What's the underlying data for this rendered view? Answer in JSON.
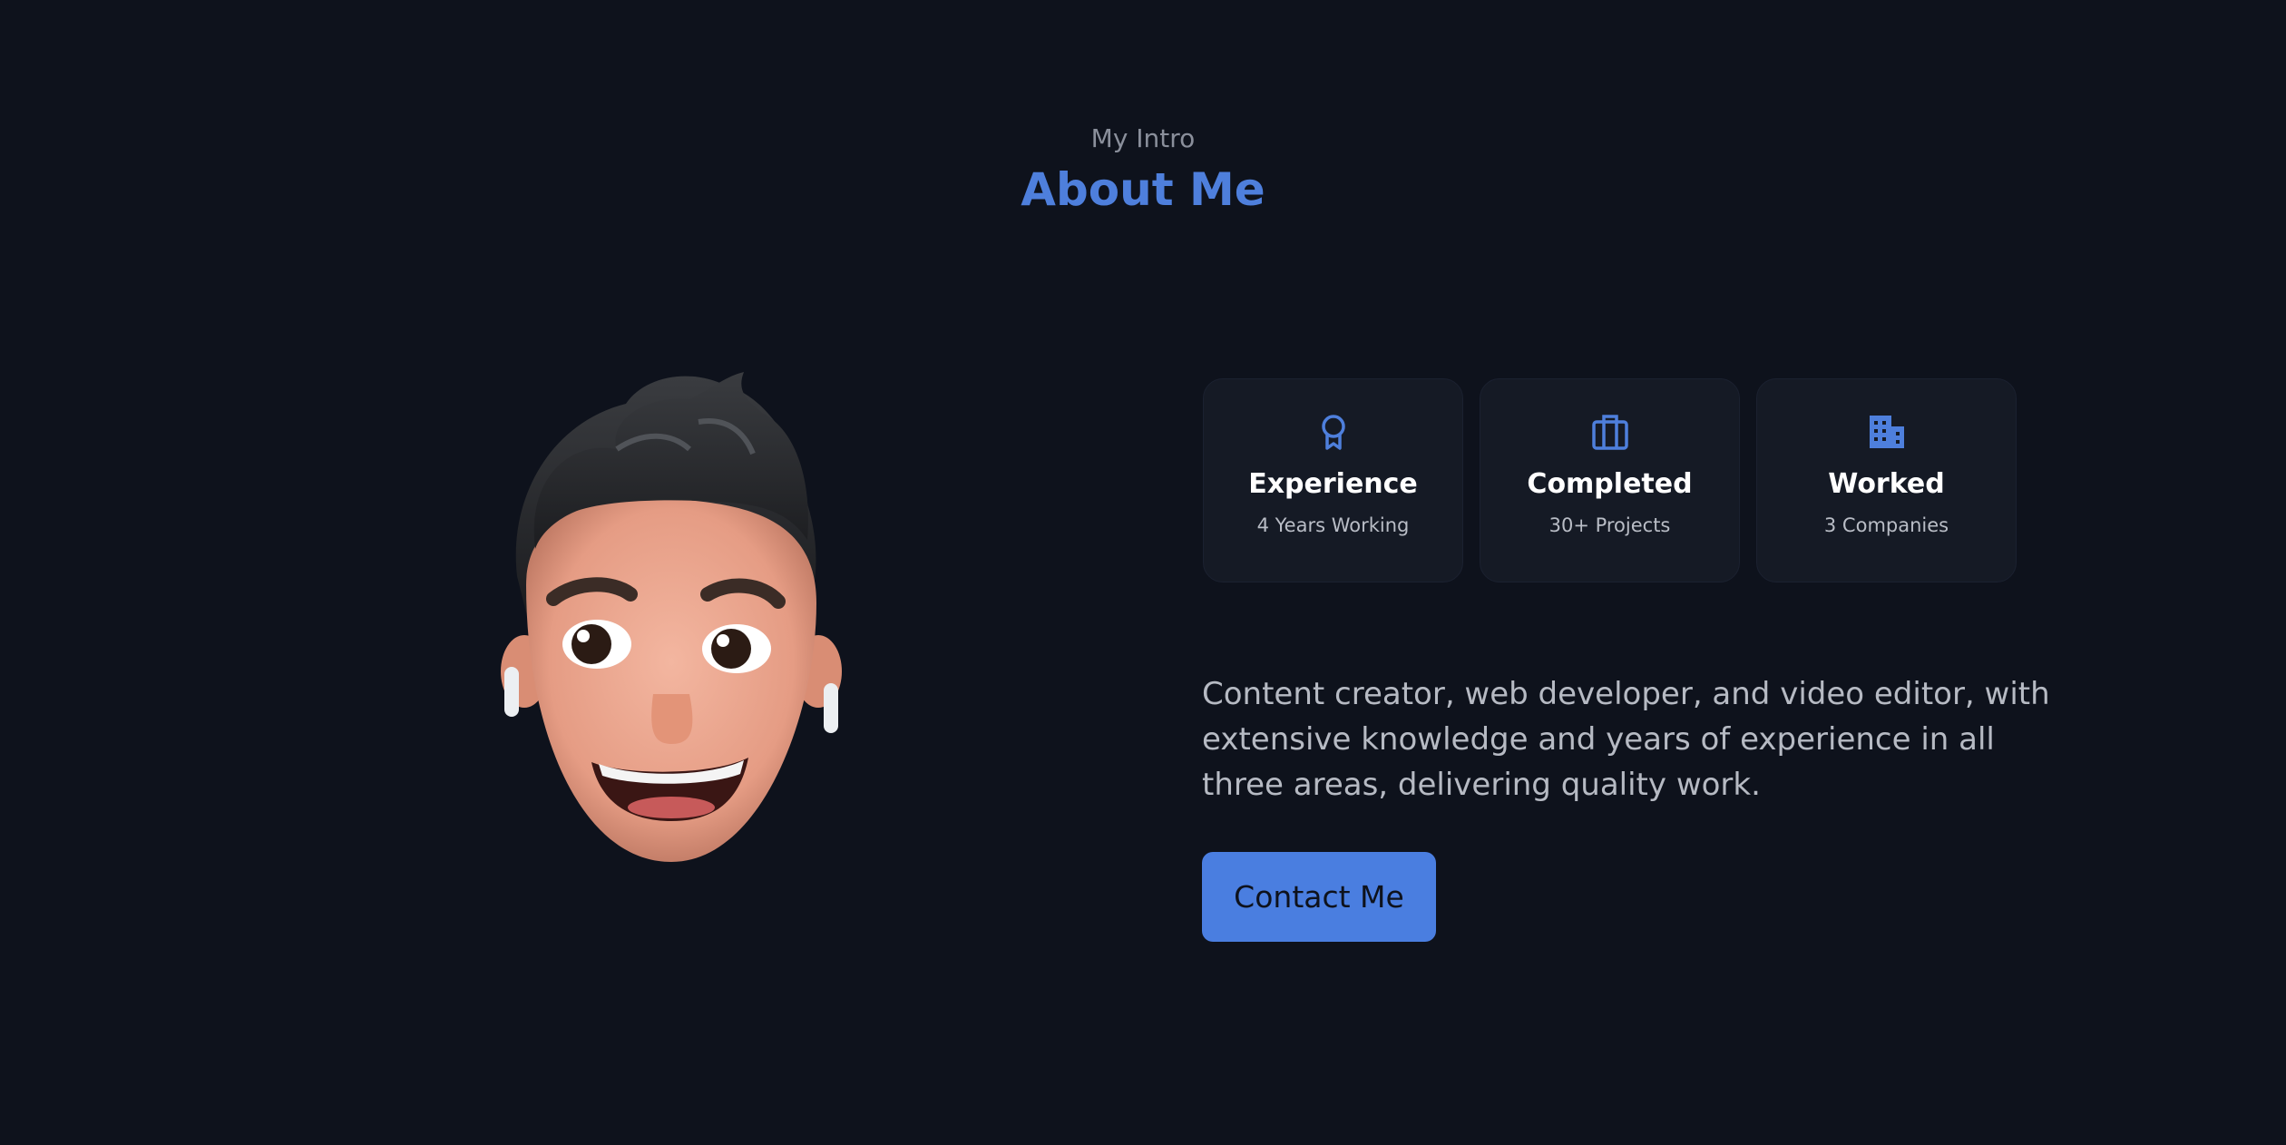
{
  "header": {
    "subtitle": "My Intro",
    "title": "About Me"
  },
  "avatar": {
    "icon": "memoji-avatar"
  },
  "stats": [
    {
      "icon": "award-icon",
      "title": "Experience",
      "subtitle": "4 Years Working"
    },
    {
      "icon": "briefcase-icon",
      "title": "Completed",
      "subtitle": "30+ Projects"
    },
    {
      "icon": "building-icon",
      "title": "Worked",
      "subtitle": "3 Companies"
    }
  ],
  "description": "Content creator, web developer, and video editor, with extensive knowledge and years of experience in all three areas, delivering quality work.",
  "contact_button": {
    "label": "Contact Me"
  },
  "colors": {
    "background": "#0e121c",
    "accent": "#4a7ee0",
    "card": "#151a25"
  }
}
